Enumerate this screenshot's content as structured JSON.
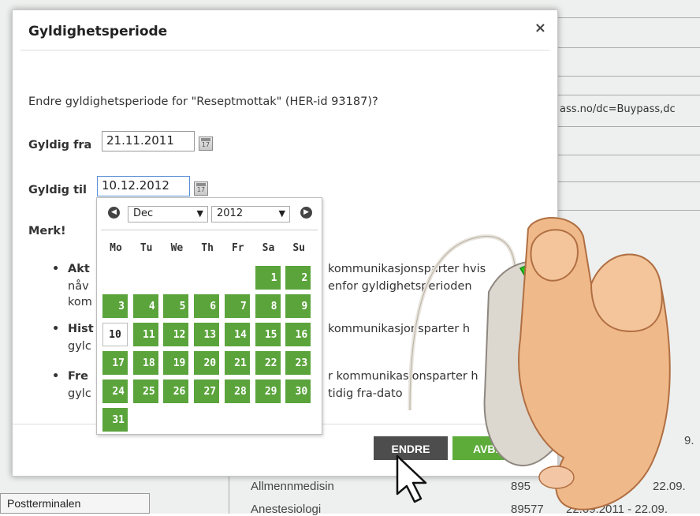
{
  "background": {
    "page_snippet_text": "ass.no/dc=Buypass,dc",
    "left_tab_label": "Postterminalen",
    "rows": [
      {
        "specialty": "Allmennmedisin",
        "code": "895",
        "date": "22.09."
      },
      {
        "specialty": "Anestesiologi",
        "code": "89577",
        "date": "22.09.2011 - 22.09."
      }
    ],
    "row_fragment": "9."
  },
  "dialog": {
    "title": "Gyldighetsperiode",
    "close_glyph": "×",
    "question": "Endre gyldighetsperiode for \"Reseptmottak\" (HER-id 93187)?",
    "valid_from_label": "Gyldig fra",
    "valid_from_value": "21.11.2011",
    "valid_to_label": "Gyldig til",
    "valid_to_value": "10.12.2012",
    "note_label": "Merk!",
    "bullets": [
      {
        "bold": "Akt",
        "line1_tail": "kommunikasjonsparter hvis",
        "line2": "nåv",
        "line2_tail": "enfor gyldighetsperioden",
        "line3": "kom"
      },
      {
        "bold": "Hist",
        "line1_tail": "kommunikasjonsparter h",
        "line2": "gylc"
      },
      {
        "bold": "Fre",
        "line1_tail": "r kommunikasjonsparter h",
        "line2": "gylc",
        "line2_tail": "tidig fra-dato"
      }
    ],
    "buttons": {
      "change": "ENDRE",
      "cancel": "AVBRYT"
    },
    "colors": {
      "accent_green": "#5dac3a",
      "dark_button": "#4d4d4d"
    }
  },
  "calendar": {
    "month": "Dec",
    "year": "2012",
    "weekdays": [
      "Mo",
      "Tu",
      "We",
      "Th",
      "Fr",
      "Sa",
      "Su"
    ],
    "first_weekday_index": 5,
    "days_in_month": 31,
    "selected_day": 10,
    "prev_icon": "prev-month-icon",
    "next_icon": "next-month-icon"
  }
}
